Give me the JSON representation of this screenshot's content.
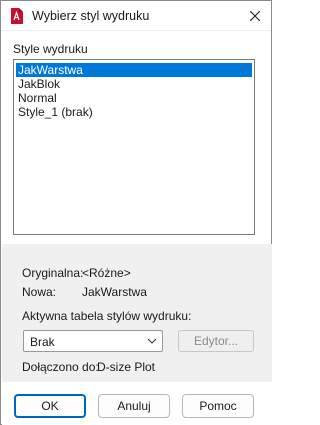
{
  "window": {
    "title": "Wybierz styl wydruku",
    "icon": "autocad-app-icon",
    "accent_color": "#0078d7"
  },
  "list": {
    "label": "Style wydruku",
    "items": [
      "JakWarstwa",
      "JakBlok",
      "Normal",
      "Style_1 (brak)"
    ],
    "selected": "JakWarstwa"
  },
  "info": {
    "original_label": "Oryginalna:",
    "original_value": "<Różne>",
    "new_label": "Nowa:",
    "new_value": "JakWarstwa",
    "active_table_label": "Aktywna tabela stylów wydruku:",
    "active_table_value": "Brak",
    "edit_label": "Edytor...",
    "attached_label": "Dołączono do:",
    "attached_value": "D-size Plot"
  },
  "buttons": {
    "ok": "OK",
    "cancel": "Anuluj",
    "help": "Pomoc"
  }
}
